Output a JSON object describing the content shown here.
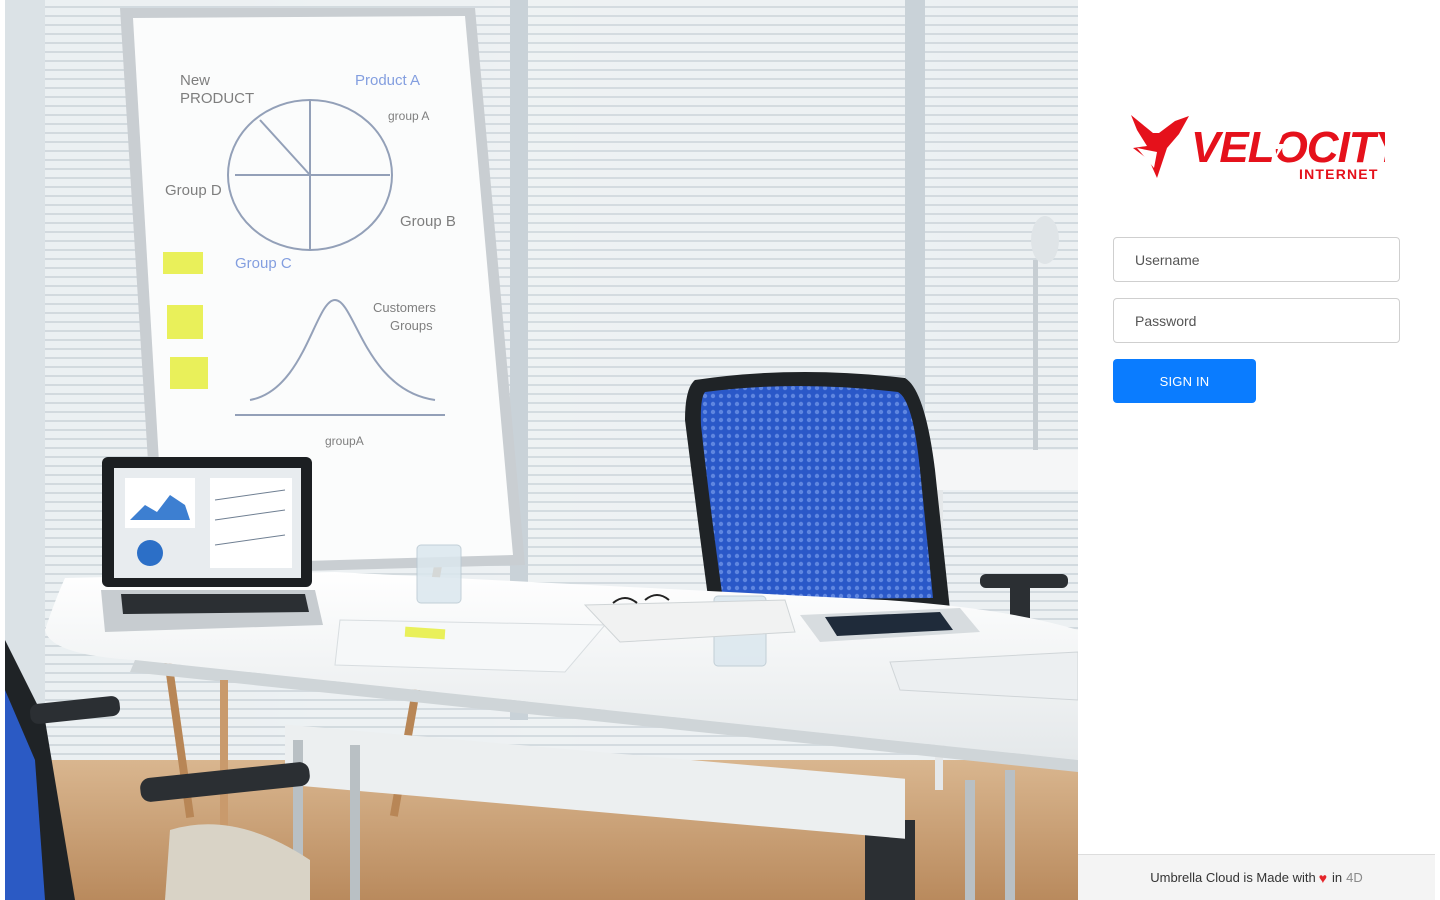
{
  "logo": {
    "brand": "VELOCITY",
    "subtitle": "INTERNET",
    "color": "#e5111b"
  },
  "form": {
    "username_placeholder": "Username",
    "password_placeholder": "Password",
    "signin_label": "SIGN IN"
  },
  "footer": {
    "prefix": "Umbrella Cloud is Made with",
    "heart_icon": "heart-icon",
    "in_text": "in",
    "brand": "4D"
  },
  "colors": {
    "accent": "#0a7cff",
    "heart": "#e5252a"
  }
}
